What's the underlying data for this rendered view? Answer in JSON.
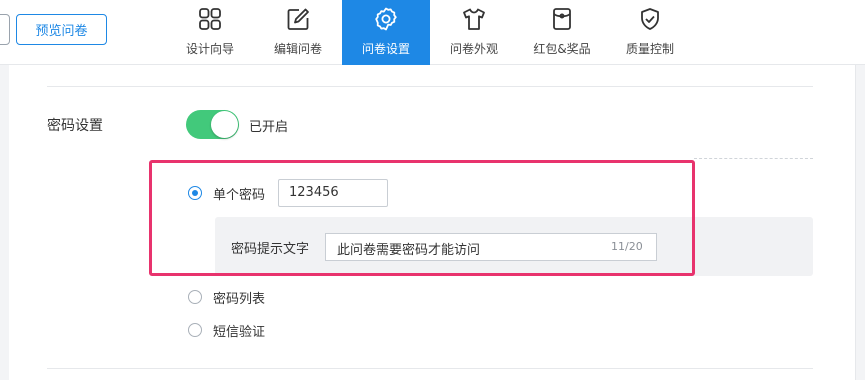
{
  "header": {
    "preview_label": "预览问卷",
    "nav": [
      {
        "label": "设计向导",
        "icon": "grid-icon"
      },
      {
        "label": "编辑问卷",
        "icon": "edit-icon"
      },
      {
        "label": "问卷设置",
        "icon": "gear-icon",
        "active": true
      },
      {
        "label": "问卷外观",
        "icon": "shirt-icon"
      },
      {
        "label": "红包&奖品",
        "icon": "red-packet-icon"
      },
      {
        "label": "质量控制",
        "icon": "shield-check-icon"
      }
    ]
  },
  "password_settings": {
    "label": "密码设置",
    "toggle_on": true,
    "toggle_text": "已开启",
    "options": [
      {
        "label": "单个密码",
        "selected": true
      },
      {
        "label": "密码列表",
        "selected": false
      },
      {
        "label": "短信验证",
        "selected": false
      }
    ],
    "single_password_value": "123456",
    "hint": {
      "label": "密码提示文字",
      "value": "此问卷需要密码才能访问",
      "count": "11/20"
    }
  },
  "colors": {
    "accent": "#1e88e5",
    "toggle_on": "#42c97b",
    "highlight_border": "#e8336d"
  }
}
